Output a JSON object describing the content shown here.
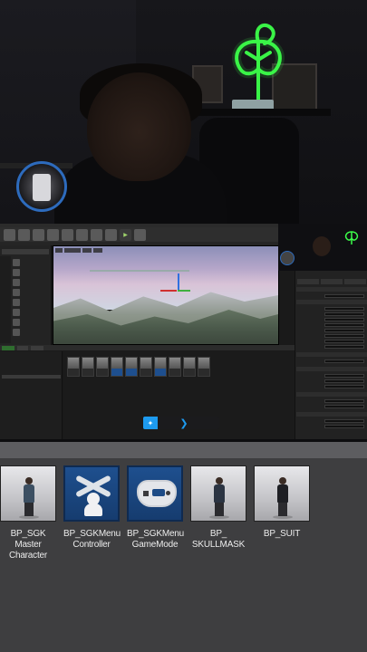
{
  "assets": [
    {
      "label": "BP_SGK Master Character",
      "thumb": "character-icon"
    },
    {
      "label": "BP_SGKMenu Controller",
      "thumb": "controller-blueprint-icon"
    },
    {
      "label": "BP_SGKMenu GameMode",
      "thumb": "gamepad-icon"
    },
    {
      "label": "BP_ SKULLMASK",
      "thumb": "character-icon"
    },
    {
      "label": "BP_SUIT",
      "thumb": "character-icon"
    }
  ],
  "colors": {
    "neon": "#3cff4a",
    "twitter": "#1d9bf0",
    "panel": "#3e3e40",
    "selected_thumb": "#1e4f8e"
  }
}
